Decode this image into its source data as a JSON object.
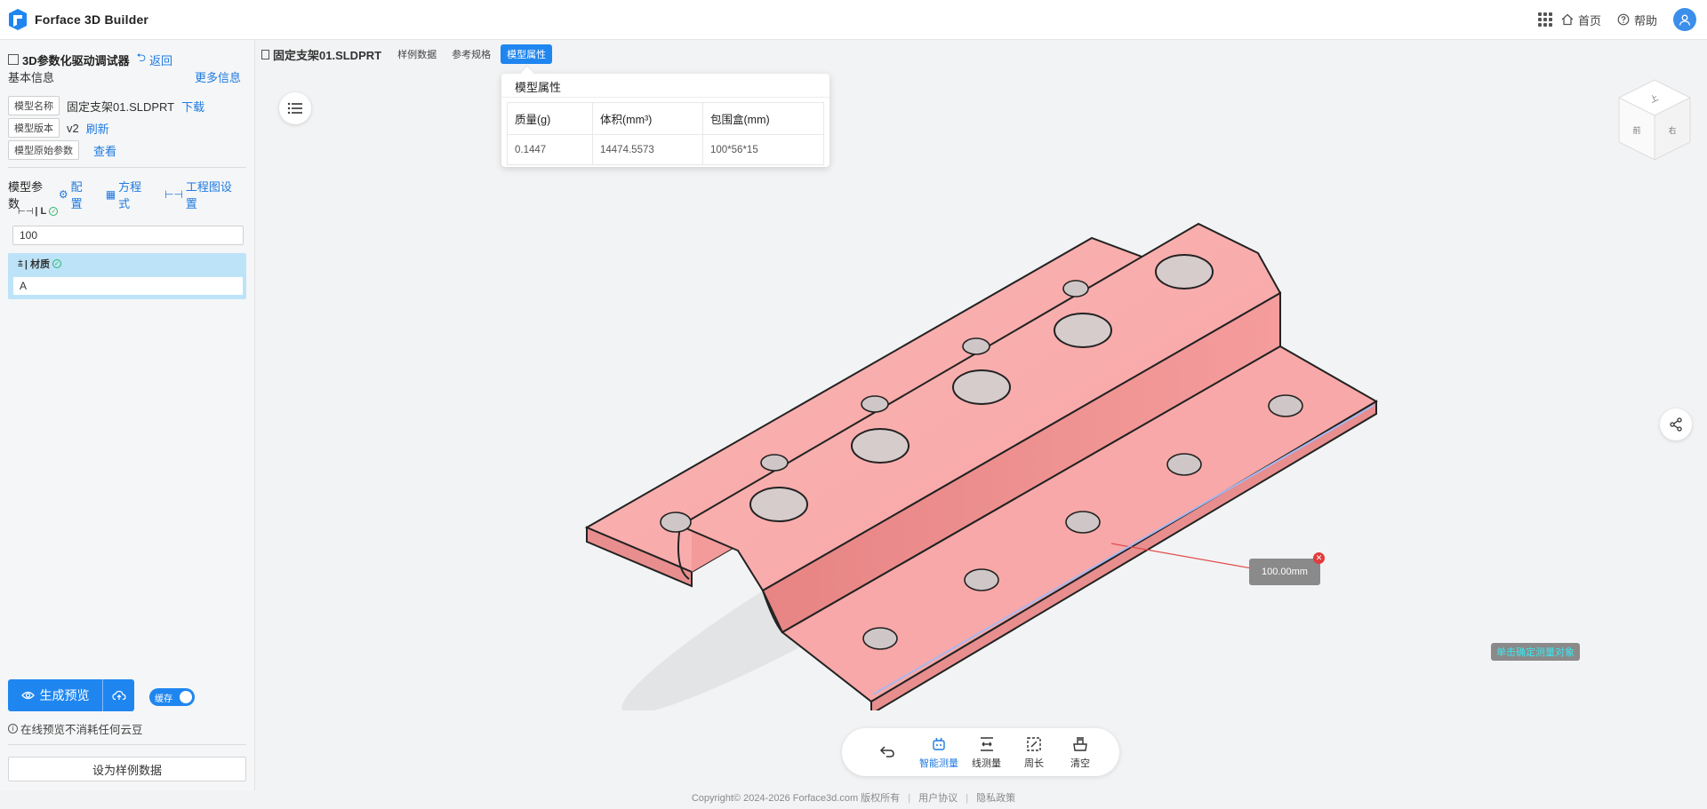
{
  "app": {
    "title": "Forface 3D Builder"
  },
  "topnav": {
    "home": "首页",
    "help": "帮助"
  },
  "sidebar": {
    "title": "3D参数化驱动调试器",
    "back": "返回",
    "basic_info": "基本信息",
    "more_info": "更多信息",
    "model_name_tag": "模型名称",
    "model_name": "固定支架01.SLDPRT",
    "download": "下载",
    "model_version_tag": "模型版本",
    "model_version": "v2",
    "refresh": "刷新",
    "model_params_tag": "模型原始参数",
    "view": "查看",
    "params_label": "模型参数",
    "config": "配置",
    "equation": "方程式",
    "drawing_settings": "工程图设置",
    "param_L_label": "| L",
    "param_L_value": "100",
    "param_material_label": "| 材质",
    "param_material_value": "A",
    "preview_button": "生成预览",
    "cache_toggle": "缓存",
    "tip": "在线预览不消耗任何云豆",
    "sample_button": "设为样例数据"
  },
  "tabs": {
    "file": "固定支架01.SLDPRT",
    "items": [
      "样例数据",
      "参考规格",
      "模型属性"
    ],
    "active": "模型属性"
  },
  "popover": {
    "title": "模型属性",
    "headers": [
      "质量(g)",
      "体积(mm³)",
      "包围盒(mm)"
    ],
    "values": [
      "0.1447",
      "14474.5573",
      "100*56*15"
    ]
  },
  "viewport": {
    "measurement": "100.00mm",
    "hint": "单击确定测量对象"
  },
  "toolbar": {
    "smart_measure": "智能测量",
    "line_measure": "线测量",
    "perimeter": "周长",
    "clear": "清空"
  },
  "footer": {
    "copyright": "Copyright© 2024-2026 Forface3d.com 版权所有",
    "agreement": "用户协议",
    "privacy": "隐私政策"
  },
  "colors": {
    "accent": "#1f86f0",
    "part": "#f7a3a3",
    "part_dark": "#e98a8a"
  }
}
